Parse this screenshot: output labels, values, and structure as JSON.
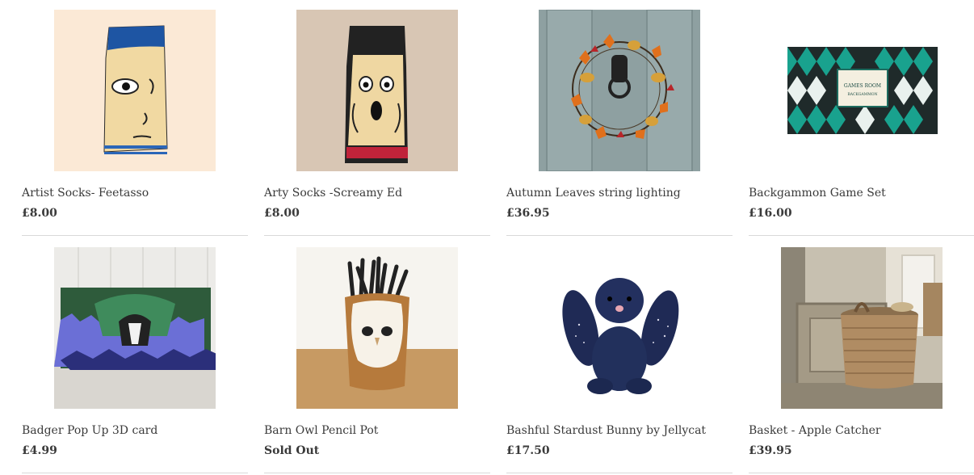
{
  "products": [
    {
      "title": "Artist Socks- Feetasso",
      "price": "£8.00"
    },
    {
      "title": "Arty Socks -Screamy Ed",
      "price": "£8.00"
    },
    {
      "title": "Autumn Leaves string lighting",
      "price": "£36.95"
    },
    {
      "title": "Backgammon Game Set",
      "price": "£16.00"
    },
    {
      "title": "Badger Pop Up 3D card",
      "price": "£4.99"
    },
    {
      "title": "Barn Owl Pencil Pot",
      "price": "Sold Out"
    },
    {
      "title": "Bashful Stardust Bunny by Jellycat",
      "price": "£17.50"
    },
    {
      "title": "Basket - Apple Catcher",
      "price": "£39.95"
    }
  ],
  "box_label": {
    "line1": "GAMES ROOM",
    "line2": "BACKGAMMON"
  }
}
